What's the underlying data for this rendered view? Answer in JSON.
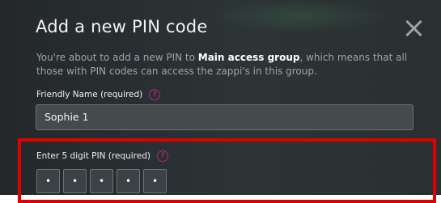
{
  "modal": {
    "title": "Add a new PIN code",
    "description_before": "You're about to add a new PIN to ",
    "group_name": "Main access group",
    "description_after": ", which means that all those with PIN codes can access the zappi's in this group."
  },
  "icons": {
    "close": "close-icon",
    "help": "help-question-icon"
  },
  "friendly_name": {
    "label": "Friendly Name (required)",
    "help_glyph": "?",
    "value": "Sophie 1"
  },
  "pin": {
    "label": "Enter 5 digit PIN (required)",
    "help_glyph": "?",
    "digits": [
      "•",
      "•",
      "•",
      "•",
      "•"
    ]
  },
  "colors": {
    "accent": "#b0277c",
    "highlight": "#e10000",
    "background": "#2a3032"
  }
}
